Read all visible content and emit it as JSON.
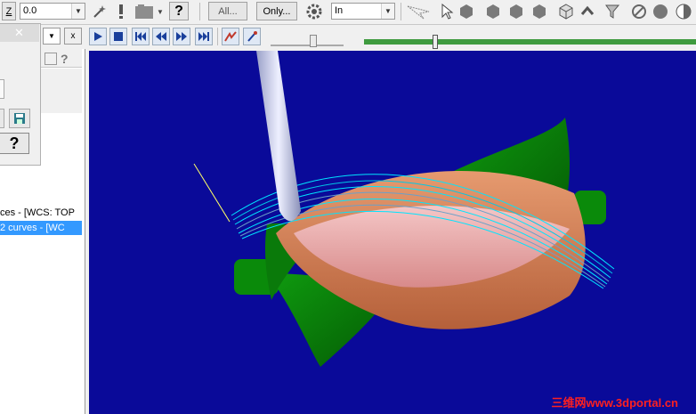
{
  "toolbar": {
    "z_label": "Z",
    "z_value": "0.0",
    "btn_all": "All...",
    "btn_only": "Only...",
    "units_value": "In"
  },
  "dialog": {
    "close_glyph": "✕"
  },
  "list": {
    "rows": [
      {
        "text": "ces - [WCS: TOP"
      },
      {
        "text": "2 curves - [WC"
      }
    ]
  },
  "viewport": {
    "background": "#0a0a99"
  },
  "watermark": {
    "text": "三维网www.3dportal.cn"
  },
  "colors": {
    "progress": "#3f9b3f",
    "selection": "#3399ff"
  }
}
